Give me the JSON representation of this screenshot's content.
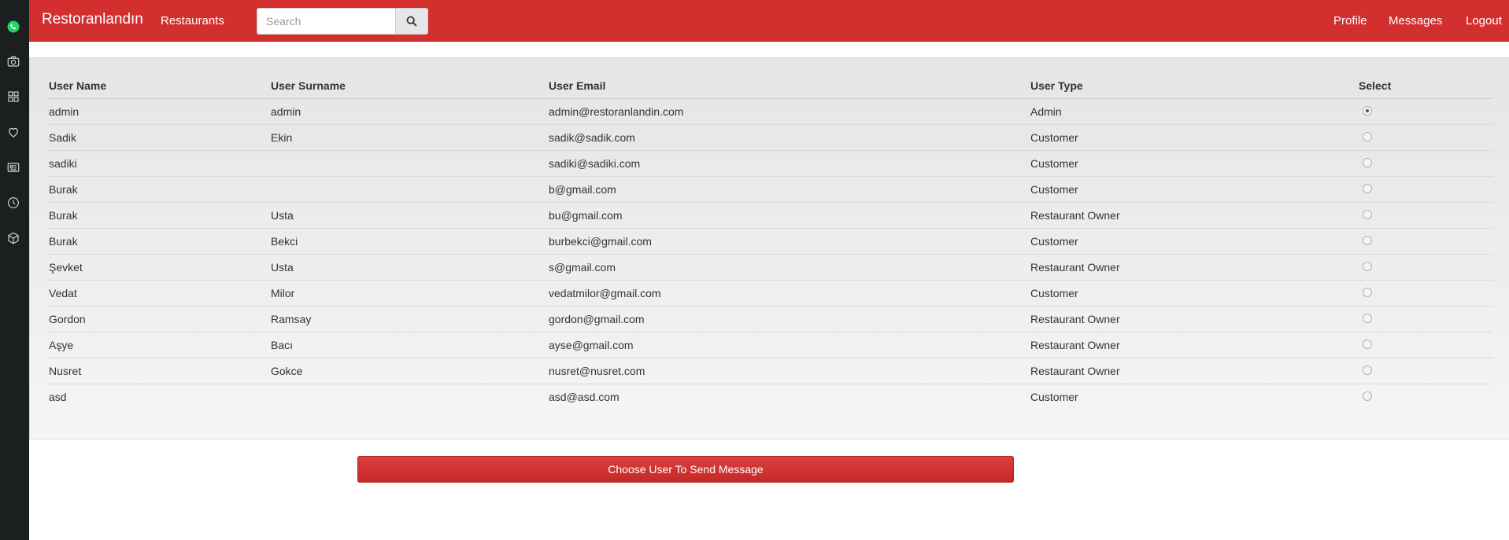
{
  "navbar": {
    "brand": "Restoranlandın",
    "restaurants_link": "Restaurants",
    "search_placeholder": "Search",
    "profile_link": "Profile",
    "messages_link": "Messages",
    "logout_link": "Logout",
    "color": "#d32f2f"
  },
  "dock": {
    "icons": [
      "whatsapp-icon",
      "camera-icon",
      "grid-icon",
      "heart-icon",
      "news-icon",
      "clock-icon",
      "box-icon"
    ]
  },
  "table": {
    "headers": {
      "name": "User Name",
      "surname": "User Surname",
      "email": "User Email",
      "type": "User Type",
      "select": "Select"
    },
    "rows": [
      {
        "name": "admin",
        "surname": "admin",
        "email": "admin@restoranlandin.com",
        "type": "Admin",
        "selected": true
      },
      {
        "name": "Sadik",
        "surname": "Ekin",
        "email": "sadik@sadik.com",
        "type": "Customer",
        "selected": false
      },
      {
        "name": "sadiki",
        "surname": "",
        "email": "sadiki@sadiki.com",
        "type": "Customer",
        "selected": false
      },
      {
        "name": "Burak",
        "surname": "",
        "email": "b@gmail.com",
        "type": "Customer",
        "selected": false
      },
      {
        "name": "Burak",
        "surname": "Usta",
        "email": "bu@gmail.com",
        "type": "Restaurant Owner",
        "selected": false
      },
      {
        "name": "Burak",
        "surname": "Bekci",
        "email": "burbekci@gmail.com",
        "type": "Customer",
        "selected": false
      },
      {
        "name": "Şevket",
        "surname": "Usta",
        "email": "s@gmail.com",
        "type": "Restaurant Owner",
        "selected": false
      },
      {
        "name": "Vedat",
        "surname": "Milor",
        "email": "vedatmilor@gmail.com",
        "type": "Customer",
        "selected": false
      },
      {
        "name": "Gordon",
        "surname": "Ramsay",
        "email": "gordon@gmail.com",
        "type": "Restaurant Owner",
        "selected": false
      },
      {
        "name": "Aşye",
        "surname": "Bacı",
        "email": "ayse@gmail.com",
        "type": "Restaurant Owner",
        "selected": false
      },
      {
        "name": "Nusret",
        "surname": "Gokce",
        "email": "nusret@nusret.com",
        "type": "Restaurant Owner",
        "selected": false
      },
      {
        "name": "asd",
        "surname": "",
        "email": "asd@asd.com",
        "type": "Customer",
        "selected": false
      }
    ]
  },
  "action": {
    "send_button": "Choose User To Send Message"
  }
}
